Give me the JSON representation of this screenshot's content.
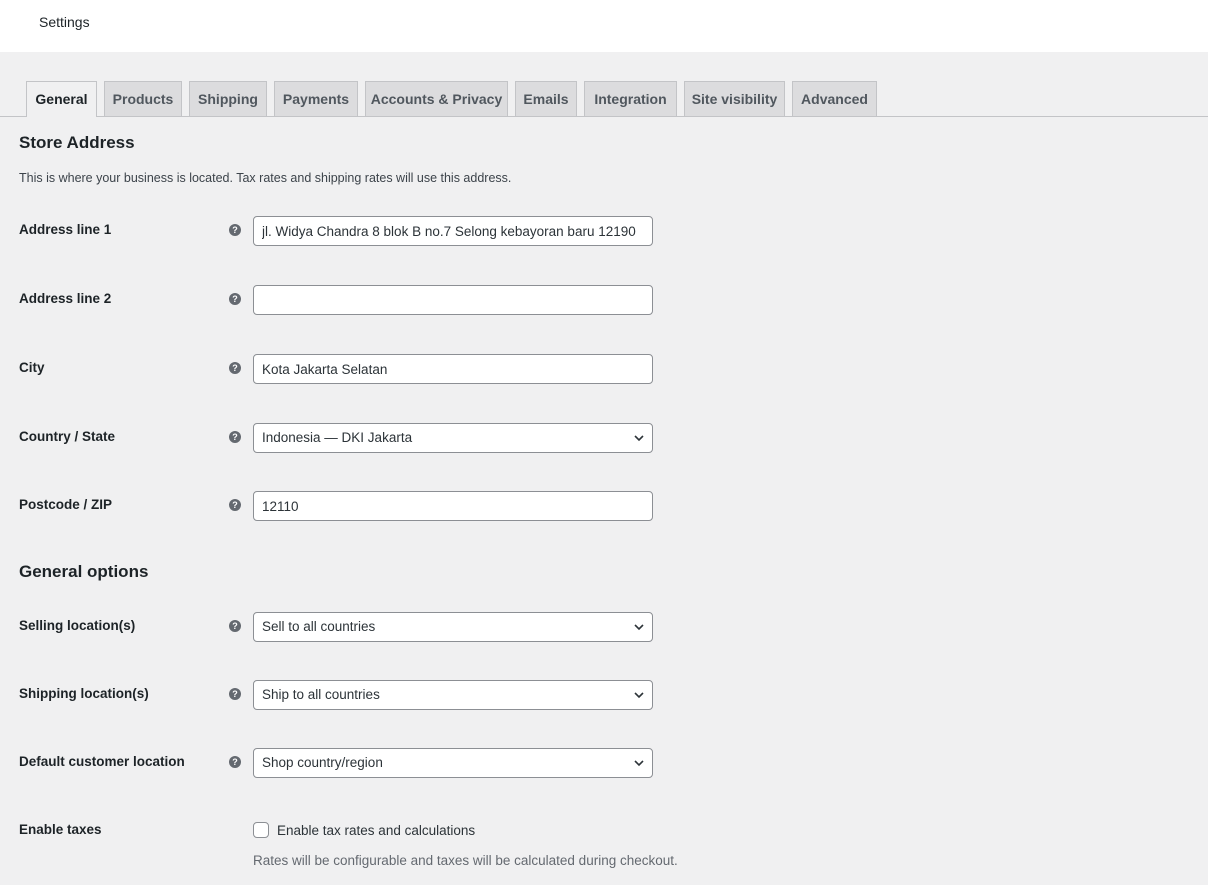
{
  "header": {
    "title": "Settings"
  },
  "tabs": [
    {
      "label": "General",
      "active": true
    },
    {
      "label": "Products"
    },
    {
      "label": "Shipping"
    },
    {
      "label": "Payments"
    },
    {
      "label": "Accounts & Privacy"
    },
    {
      "label": "Emails"
    },
    {
      "label": "Integration"
    },
    {
      "label": "Site visibility"
    },
    {
      "label": "Advanced"
    }
  ],
  "store_address": {
    "heading": "Store Address",
    "description": "This is where your business is located. Tax rates and shipping rates will use this address.",
    "address1": {
      "label": "Address line 1",
      "value": "jl. Widya Chandra 8 blok B no.7 Selong kebayoran baru 12190"
    },
    "address2": {
      "label": "Address line 2",
      "value": ""
    },
    "city": {
      "label": "City",
      "value": "Kota Jakarta Selatan"
    },
    "country": {
      "label": "Country / State",
      "value": "Indonesia — DKI Jakarta"
    },
    "postcode": {
      "label": "Postcode / ZIP",
      "value": "12110"
    }
  },
  "general_options": {
    "heading": "General options",
    "selling": {
      "label": "Selling location(s)",
      "value": "Sell to all countries"
    },
    "shipping": {
      "label": "Shipping location(s)",
      "value": "Ship to all countries"
    },
    "default_location": {
      "label": "Default customer location",
      "value": "Shop country/region"
    },
    "taxes": {
      "label": "Enable taxes",
      "checkbox_label": "Enable tax rates and calculations",
      "checked": false,
      "note": "Rates will be configurable and taxes will be calculated during checkout."
    }
  },
  "icons": {
    "help": "help-question-icon",
    "dropdown": "chevron-down-icon"
  },
  "colors": {
    "background": "#f0f0f1",
    "tab_inactive": "#dcdcde",
    "help_icon": "#646970"
  }
}
